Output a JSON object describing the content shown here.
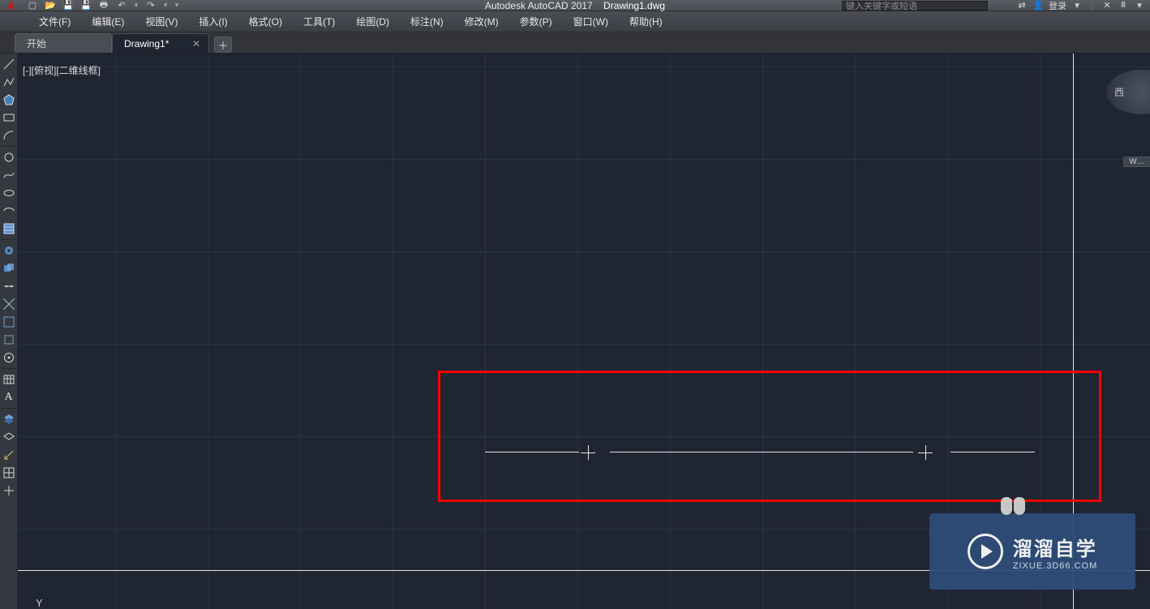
{
  "app": {
    "name": "Autodesk AutoCAD 2017",
    "filename": "Drawing1.dwg"
  },
  "search": {
    "placeholder": "键入关键字或短语"
  },
  "login": {
    "label": "登录"
  },
  "menus": [
    "文件(F)",
    "编辑(E)",
    "视图(V)",
    "插入(I)",
    "格式(O)",
    "工具(T)",
    "绘图(D)",
    "标注(N)",
    "修改(M)",
    "参数(P)",
    "窗口(W)",
    "帮助(H)"
  ],
  "tabs": {
    "start": "开始",
    "active": "Drawing1*"
  },
  "viewportControl": "[-][俯视][二维线框]",
  "navcube": {
    "face": "西"
  },
  "wcs": "W…",
  "axis": {
    "y": "Y"
  },
  "watermark": {
    "big": "溜溜自学",
    "small": "ZIXUE.3D66.COM"
  },
  "leftToolbarGroups": [
    [
      "line",
      "pline",
      "polygon",
      "rect",
      "arc"
    ],
    [
      "circle",
      "spline",
      "ellipse",
      "ellipse-arc",
      "hatch"
    ],
    [
      "donut",
      "region",
      "divide",
      "xline",
      "ray"
    ],
    [
      "table",
      "text"
    ],
    [
      "layers",
      "layers-off",
      "dim",
      "grid-tool",
      "move"
    ]
  ]
}
